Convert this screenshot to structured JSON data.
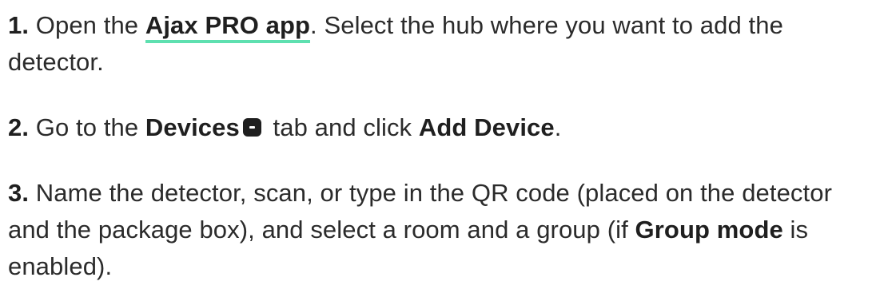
{
  "steps": [
    {
      "number": "1.",
      "text_before_link": "Open the ",
      "link_label": "Ajax PRO app",
      "text_after_link": ". Select the hub where you want to add the detector."
    },
    {
      "number": "2.",
      "text_1": "Go to the ",
      "bold_1": "Devices",
      "icon": "devices-tab-icon",
      "text_2": " tab and click ",
      "bold_2": "Add Device",
      "text_3": "."
    },
    {
      "number": "3.",
      "text_1": "Name the detector, scan, or type in the QR code (placed on the detector and the package box), and select a room and a group (if ",
      "bold_1": "Group mode",
      "text_2": " is enabled)."
    }
  ],
  "colors": {
    "link_underline": "#5ee0b0",
    "text": "#2b2b2b",
    "icon": "#1e1e1e"
  }
}
